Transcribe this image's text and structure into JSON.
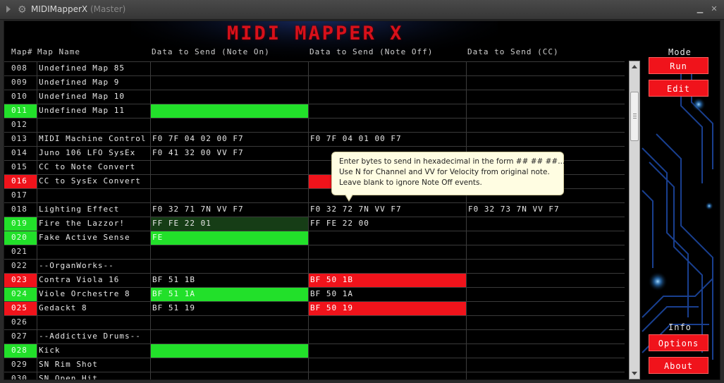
{
  "window": {
    "title": "MIDIMapperX",
    "subtitle": "(Master)"
  },
  "app": {
    "logo_text": "MIDI MAPPER X"
  },
  "headers": {
    "map_num": "Map#",
    "map_name": "Map Name",
    "note_on": "Data to Send (Note On)",
    "note_off": "Data to Send (Note Off)",
    "cc": "Data to Send (CC)"
  },
  "rows": [
    {
      "num": "008",
      "name": "Undefined Map 85",
      "on": "",
      "off": "",
      "cc": "",
      "ind": "",
      "on_fill": "",
      "off_fill": ""
    },
    {
      "num": "009",
      "name": "Undefined Map 9",
      "on": "",
      "off": "",
      "cc": "",
      "ind": "",
      "on_fill": "",
      "off_fill": ""
    },
    {
      "num": "010",
      "name": "Undefined Map 10",
      "on": "",
      "off": "",
      "cc": "",
      "ind": "",
      "on_fill": "",
      "off_fill": ""
    },
    {
      "num": "011",
      "name": "Undefined Map 11",
      "on": "",
      "off": "",
      "cc": "",
      "ind": "green",
      "on_fill": "green",
      "off_fill": ""
    },
    {
      "num": "012",
      "name": "",
      "on": "",
      "off": "",
      "cc": "",
      "ind": "",
      "on_fill": "",
      "off_fill": ""
    },
    {
      "num": "013",
      "name": "MIDI Machine Control",
      "on": "F0 7F 04 02 00 F7",
      "off": "F0 7F 04 01 00 F7",
      "cc": "",
      "ind": "",
      "on_fill": "",
      "off_fill": ""
    },
    {
      "num": "014",
      "name": "Juno 106 LFO SysEx",
      "on": "F0 41 32 00 VV F7",
      "off": "",
      "cc": "",
      "ind": "",
      "on_fill": "",
      "off_fill": ""
    },
    {
      "num": "015",
      "name": "CC to Note Convert",
      "on": "",
      "off": "",
      "cc": "",
      "ind": "",
      "on_fill": "",
      "off_fill": ""
    },
    {
      "num": "016",
      "name": "CC to SysEx Convert",
      "on": "",
      "off": "",
      "cc": "",
      "ind": "red",
      "on_fill": "",
      "off_fill": "red"
    },
    {
      "num": "017",
      "name": "",
      "on": "",
      "off": "",
      "cc": "",
      "ind": "",
      "on_fill": "",
      "off_fill": ""
    },
    {
      "num": "018",
      "name": "Lighting Effect",
      "on": "F0 32 71 7N VV F7",
      "off": "F0 32 72 7N VV F7",
      "cc": "F0 32 73 7N VV F7",
      "ind": "",
      "on_fill": "",
      "off_fill": ""
    },
    {
      "num": "019",
      "name": "Fire the Lazzor!",
      "on": "FF FE 22 01",
      "off": "FF FE 22 00",
      "cc": "",
      "ind": "green",
      "on_fill": "darkgreen",
      "off_fill": ""
    },
    {
      "num": "020",
      "name": "Fake Active Sense",
      "on": "FE",
      "off": "",
      "cc": "",
      "ind": "green",
      "on_fill": "green",
      "off_fill": ""
    },
    {
      "num": "021",
      "name": "",
      "on": "",
      "off": "",
      "cc": "",
      "ind": "",
      "on_fill": "",
      "off_fill": ""
    },
    {
      "num": "022",
      "name": "--OrganWorks--",
      "on": "",
      "off": "",
      "cc": "",
      "ind": "",
      "on_fill": "",
      "off_fill": ""
    },
    {
      "num": "023",
      "name": "Contra Viola 16",
      "on": "BF 51 1B",
      "off": "BF 50 1B",
      "cc": "",
      "ind": "red",
      "on_fill": "",
      "off_fill": "red"
    },
    {
      "num": "024",
      "name": "Viole Orchestre 8",
      "on": "BF 51 1A",
      "off": "BF 50 1A",
      "cc": "",
      "ind": "green",
      "on_fill": "green",
      "off_fill": ""
    },
    {
      "num": "025",
      "name": "Gedackt 8",
      "on": "BF 51 19",
      "off": "BF 50 19",
      "cc": "",
      "ind": "red",
      "on_fill": "",
      "off_fill": "red"
    },
    {
      "num": "026",
      "name": "",
      "on": "",
      "off": "",
      "cc": "",
      "ind": "",
      "on_fill": "",
      "off_fill": ""
    },
    {
      "num": "027",
      "name": "--Addictive Drums--",
      "on": "",
      "off": "",
      "cc": "",
      "ind": "",
      "on_fill": "",
      "off_fill": ""
    },
    {
      "num": "028",
      "name": "Kick",
      "on": "",
      "off": "",
      "cc": "",
      "ind": "green",
      "on_fill": "green",
      "off_fill": ""
    },
    {
      "num": "029",
      "name": "SN Rim Shot",
      "on": "",
      "off": "",
      "cc": "",
      "ind": "",
      "on_fill": "",
      "off_fill": ""
    },
    {
      "num": "030",
      "name": "SN Open Hit",
      "on": "",
      "off": "",
      "cc": "",
      "ind": "",
      "on_fill": "",
      "off_fill": ""
    }
  ],
  "mode": {
    "label": "Mode",
    "run": "Run",
    "edit": "Edit"
  },
  "info": {
    "label": "Info",
    "options": "Options",
    "about": "About"
  },
  "tooltip": {
    "line1": "Enter bytes to send in hexadecimal in the form ## ## ##...",
    "line2": "Use N for Channel and VV for Velocity from original note.",
    "line3": "Leave blank to ignore Note Off events."
  },
  "colors": {
    "accent_red": "#f0131b",
    "accent_green": "#22e02a",
    "dark_green": "#163d16",
    "logo_red": "#d8101a"
  }
}
